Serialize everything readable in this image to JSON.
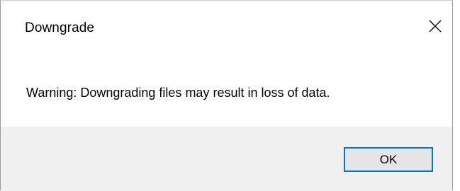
{
  "dialog": {
    "title": "Downgrade",
    "close_icon": "close-icon",
    "message": "Warning: Downgrading files may result in loss of data.",
    "ok_label": "OK"
  },
  "colors": {
    "accent_border": "#0078d7",
    "footer_background": "#f0f0f0",
    "button_background": "#e5e5e5"
  }
}
